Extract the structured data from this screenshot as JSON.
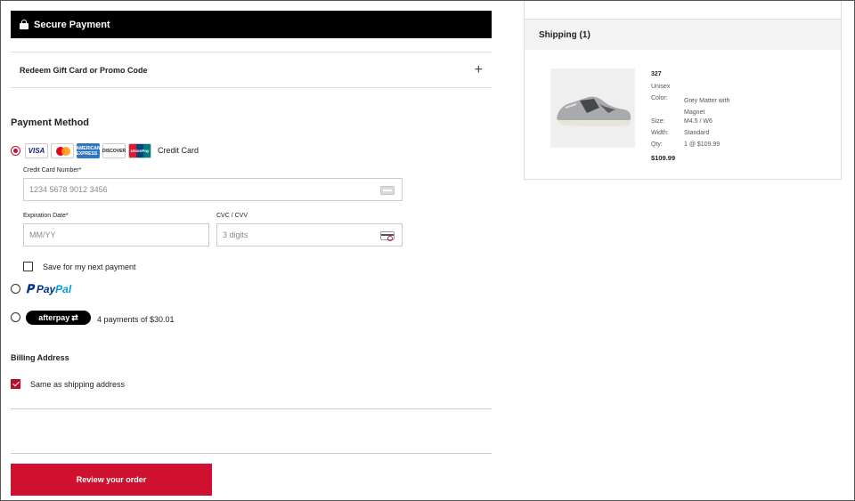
{
  "secure": {
    "title": "Secure Payment",
    "icon": "lock-icon"
  },
  "promo": {
    "label": "Redeem Gift Card or Promo Code",
    "icon": "+"
  },
  "payment": {
    "title": "Payment Method",
    "credit_label": "Credit Card",
    "card_logos": [
      "VISA",
      "MC",
      "AMERICAN EXPRESS",
      "DISCOVER",
      "UnionPay"
    ],
    "card_number_label": "Credit Card Number*",
    "card_number_placeholder": "1234 5678 9012 3456",
    "exp_label": "Expiration Date*",
    "exp_placeholder": "MM/YY",
    "cvc_label": "CVC / CVV",
    "cvc_placeholder": "3 digits",
    "save_label": "Save for my next payment",
    "paypal_pay": "Pay",
    "paypal_pal": "Pal",
    "afterpay_label": "afterpay",
    "afterpay_text": "4 payments of $30.01"
  },
  "billing": {
    "title": "Billing Address",
    "same_label": "Same as shipping address"
  },
  "review_button": "Review your order",
  "shipping": {
    "header": "Shipping (1)",
    "product": {
      "name": "327",
      "gender": "Unisex",
      "color_label": "Color:",
      "color_value": "Grey Matter with Magnet",
      "size_label": "Size:",
      "size_value": "M4.5 / W6",
      "width_label": "Width:",
      "width_value": "Standard",
      "qty_label": "Qty:",
      "qty_value": "1 @ $109.99",
      "price": "$109.99"
    }
  },
  "colors": {
    "accent": "#d0102f",
    "header_bg": "#000000"
  }
}
